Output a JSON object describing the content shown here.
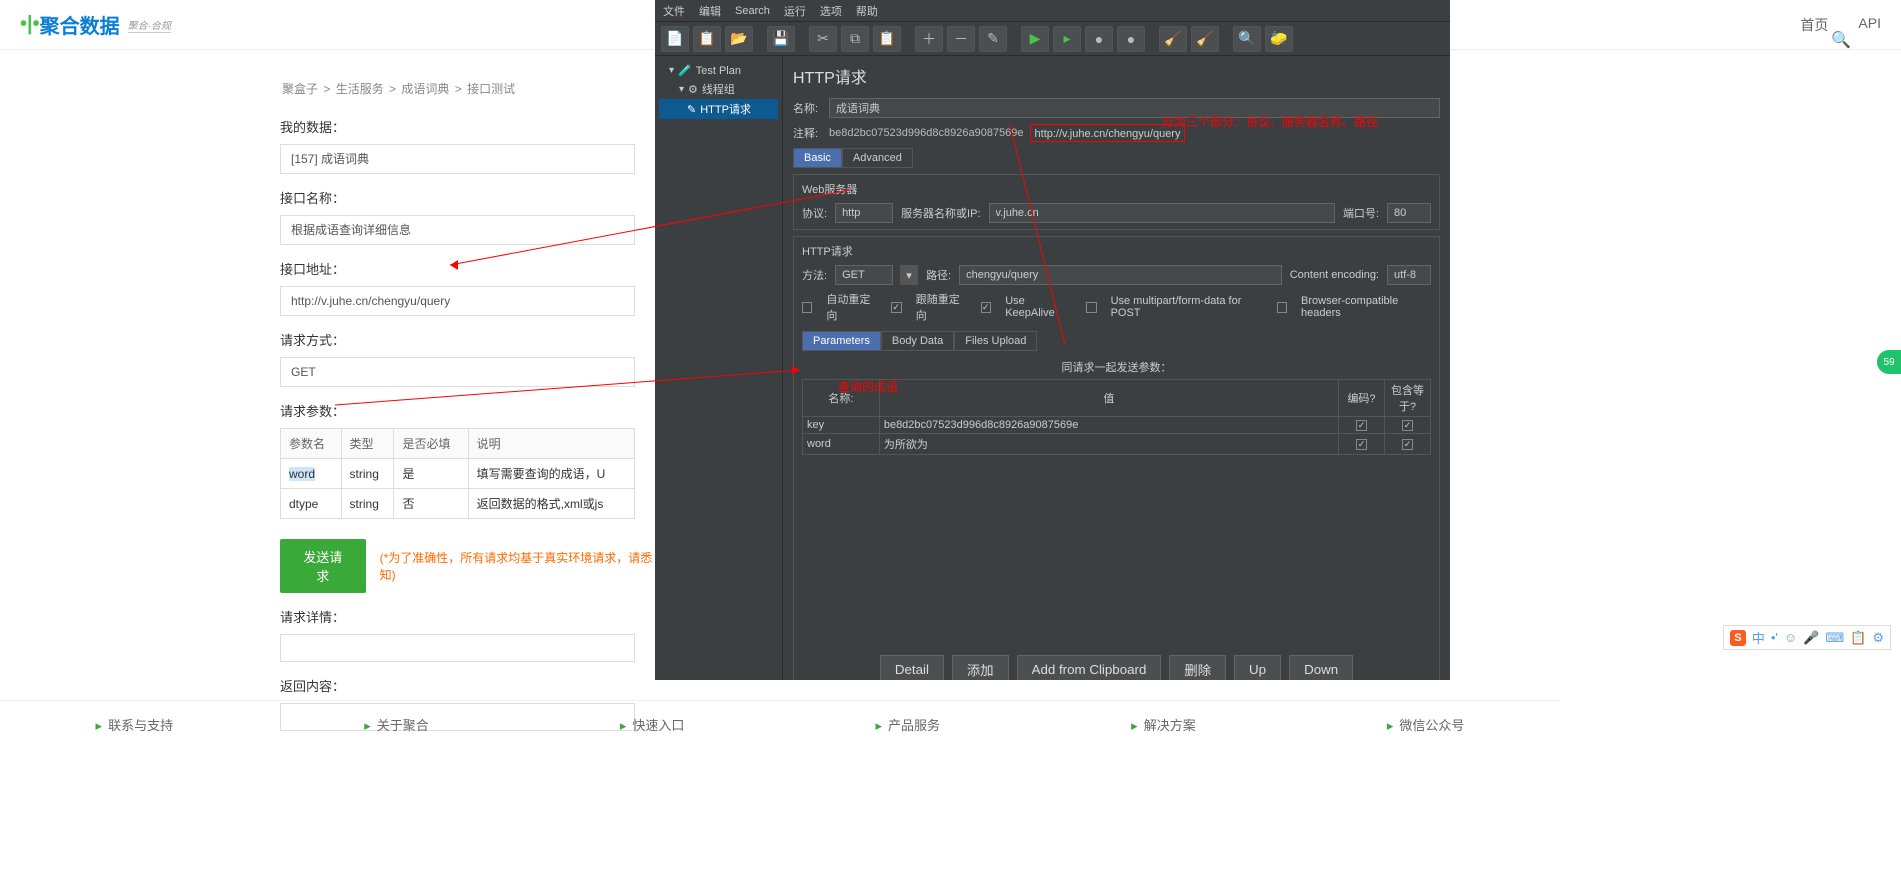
{
  "header": {
    "logo_text": "聚合数据",
    "logo_tag": "聚合·合规",
    "nav": [
      "首页",
      "API"
    ]
  },
  "breadcrumb": [
    "聚盒子",
    "生活服务",
    "成语词典",
    "接口测试"
  ],
  "labels": {
    "my_data": "我的数据：",
    "api_name": "接口名称：",
    "api_addr": "接口地址：",
    "req_method": "请求方式：",
    "req_params": "请求参数：",
    "req_detail": "请求详情：",
    "resp": "返回内容："
  },
  "values": {
    "my_data": "[157] 成语词典",
    "api_name": "根据成语查询详细信息",
    "api_addr": "http://v.juhe.cn/chengyu/query",
    "req_method": "GET"
  },
  "params_cols": [
    "参数名",
    "类型",
    "是否必填",
    "说明"
  ],
  "params_rows": [
    {
      "name": "word",
      "type": "string",
      "req": "是",
      "desc": "填写需要查询的成语，U"
    },
    {
      "name": "dtype",
      "type": "string",
      "req": "否",
      "desc": "返回数据的格式,xml或js"
    }
  ],
  "send_btn": "发送请求",
  "send_warn": "(*为了准确性，所有请求均基于真实环境请求，请悉知)",
  "jmeter": {
    "menus": [
      "文件",
      "编辑",
      "Search",
      "运行",
      "选项",
      "帮助"
    ],
    "tree": {
      "root": "Test Plan",
      "group": "线程组",
      "http": "HTTP请求"
    },
    "title": "HTTP请求",
    "name_lbl": "名称:",
    "name_val": "成语词典",
    "note_lbl": "注释:",
    "note_hash": "be8d2bc07523d996d8c8926a9087569e",
    "note_url": "http://v.juhe.cn/chengyu/query",
    "tabs_top": [
      "Basic",
      "Advanced"
    ],
    "web_server": "Web服务器",
    "proto_lbl": "协议:",
    "proto_val": "http",
    "server_lbl": "服务器名称或IP:",
    "server_val": "v.juhe.cn",
    "port_lbl": "端口号:",
    "port_val": "80",
    "http_req": "HTTP请求",
    "method_lbl": "方法:",
    "method_val": "GET",
    "path_lbl": "路径:",
    "path_val": "chengyu/query",
    "enc_lbl": "Content encoding:",
    "enc_val": "utf-8",
    "checks": [
      "自动重定向",
      "跟随重定向",
      "Use KeepAlive",
      "Use multipart/form-data for POST",
      "Browser-compatible headers"
    ],
    "tabs_param": [
      "Parameters",
      "Body Data",
      "Files Upload"
    ],
    "param_hdr": "同请求一起发送参数：",
    "param_cols": {
      "name": "名称:",
      "val": "值",
      "enc": "编码?",
      "eq": "包含等于?"
    },
    "param_rows": [
      {
        "k": "key",
        "v": "be8d2bc07523d996d8c8926a9087569e"
      },
      {
        "k": "word",
        "v": "为所欲为"
      }
    ],
    "btns": [
      "Detail",
      "添加",
      "Add from Clipboard",
      "删除",
      "Up",
      "Down"
    ]
  },
  "annotations": {
    "url_split": "分为三个部分：协议、服务器名称、路径",
    "query_word": "查询的成语"
  },
  "footer": [
    "联系与支持",
    "关于聚合",
    "快速入口",
    "产品服务",
    "解决方案",
    "微信公众号"
  ],
  "badge": "59",
  "ime": [
    "中",
    "•', ☺",
    "🎤",
    "⌨",
    "📋",
    "⚙"
  ]
}
